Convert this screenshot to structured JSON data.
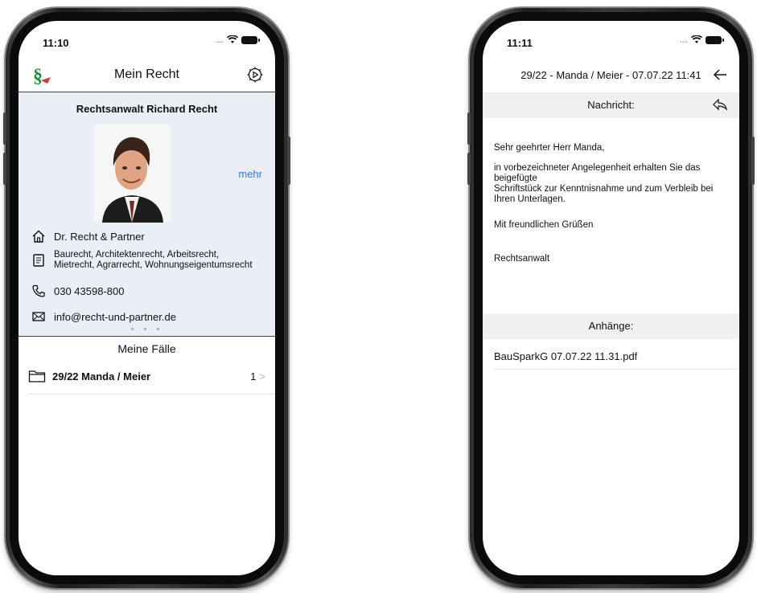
{
  "left_screen": {
    "status_time": "11:10",
    "status_dots": "....",
    "nav_title": "Mein Recht",
    "lawyer_name": "Rechtsanwalt Richard Recht",
    "more_label": "mehr",
    "firm": "Dr. Recht & Partner",
    "areas_line1": "Baurecht, Architektenrecht, Arbeitsrecht,",
    "areas_line2": "Mietrecht, Agrarrecht, Wohnungseigentumsrecht",
    "phone": "030 43598-800",
    "email": "info@recht-und-partner.de",
    "pager": "● ● ●",
    "cases_title": "Meine Fälle",
    "cases": [
      {
        "name": "29/22 Manda / Meier",
        "count": "1"
      }
    ]
  },
  "right_screen": {
    "status_time": "11:11",
    "status_dots": "....",
    "title": "29/22 - Manda / Meier - 07.07.22 11:41",
    "message_label": "Nachricht:",
    "salutation": "Sehr geehrter Herr Manda,",
    "body_line1": "in vorbezeichneter Angelegenheit erhalten Sie das",
    "body_line2": "beigefügte",
    "body_line3": "Schriftstück zur Kenntnisnahme und zum Verbleib bei",
    "body_line4": "Ihren Unterlagen.",
    "closing": "Mit freundlichen Grüßen",
    "signature": "Rechtsanwalt",
    "attachments_label": "Anhänge:",
    "attachments": [
      "BauSparkG 07.07.22 11.31.pdf"
    ]
  },
  "colors": {
    "accent": "#2f7bd8",
    "profile_bg": "#eaeef6",
    "logo_green": "#1f8f3a",
    "logo_red": "#d23a3a"
  }
}
